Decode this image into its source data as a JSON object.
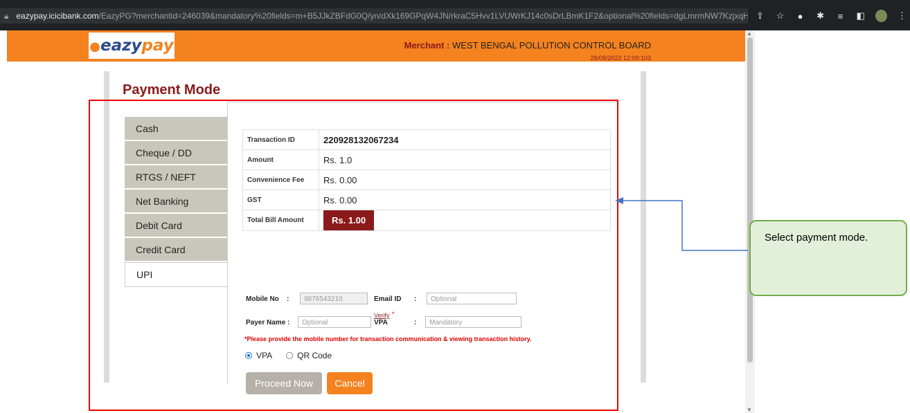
{
  "browser": {
    "url_host": "eazypay.icicibank.com",
    "url_rest": "/EazyPG?merchantid=246039&mandatory%20fields=m+B5JJkZBFdG0Q/yn/dXk169GPqW4JN/rkraC5Hvv1LVUWrKJ14c0sDrLBmK1F2&optional%20fields=dgLmrmNW7KzjxqH..."
  },
  "header": {
    "logo_text_a": "eazy",
    "logo_text_b": "pay"
  },
  "merchant": {
    "label": "Merchant :",
    "name": "WEST BENGAL POLLUTION CONTROL BOARD",
    "datetime": "28/09/2022 12:09:103"
  },
  "title": "Payment Mode",
  "tabs": [
    "Cash",
    "Cheque / DD",
    "RTGS / NEFT",
    "Net Banking",
    "Debit Card",
    "Credit Card",
    "UPI"
  ],
  "summary": {
    "transaction_id_label": "Transaction ID",
    "transaction_id": "220928132067234",
    "amount_label": "Amount",
    "amount": "Rs. 1.0",
    "fee_label": "Convenience Fee",
    "fee": "Rs. 0.00",
    "gst_label": "GST",
    "gst": "Rs. 0.00",
    "total_label": "Total Bill Amount",
    "total": "Rs. 1.00"
  },
  "form": {
    "mobile_label": "Mobile No",
    "mobile_colon": ":",
    "mobile_value": "9876543210",
    "email_label": "Email ID",
    "email_colon": ":",
    "email_placeholder": "Optional",
    "payer_label": "Payer Name :",
    "payer_placeholder": "Optional",
    "vpa_label": "VPA",
    "vpa_colon": ":",
    "vpa_placeholder": "Mandatory",
    "verify_label": "Verify",
    "star": "*"
  },
  "notice": "*Please provide the mobile number for transaction communication & viewing transaction history.",
  "radios": {
    "vpa": "VPA",
    "qr": "QR Code",
    "selected": "VPA"
  },
  "buttons": {
    "proceed": "Proceed Now",
    "cancel": "Cancel"
  },
  "callout": "Select payment mode.",
  "colors": {
    "brand_orange": "#f4821f",
    "brand_maroon": "#8b1a1a",
    "highlight_red": "#e00000",
    "callout_green": "#70ad47",
    "arrow_blue": "#4472c4"
  }
}
